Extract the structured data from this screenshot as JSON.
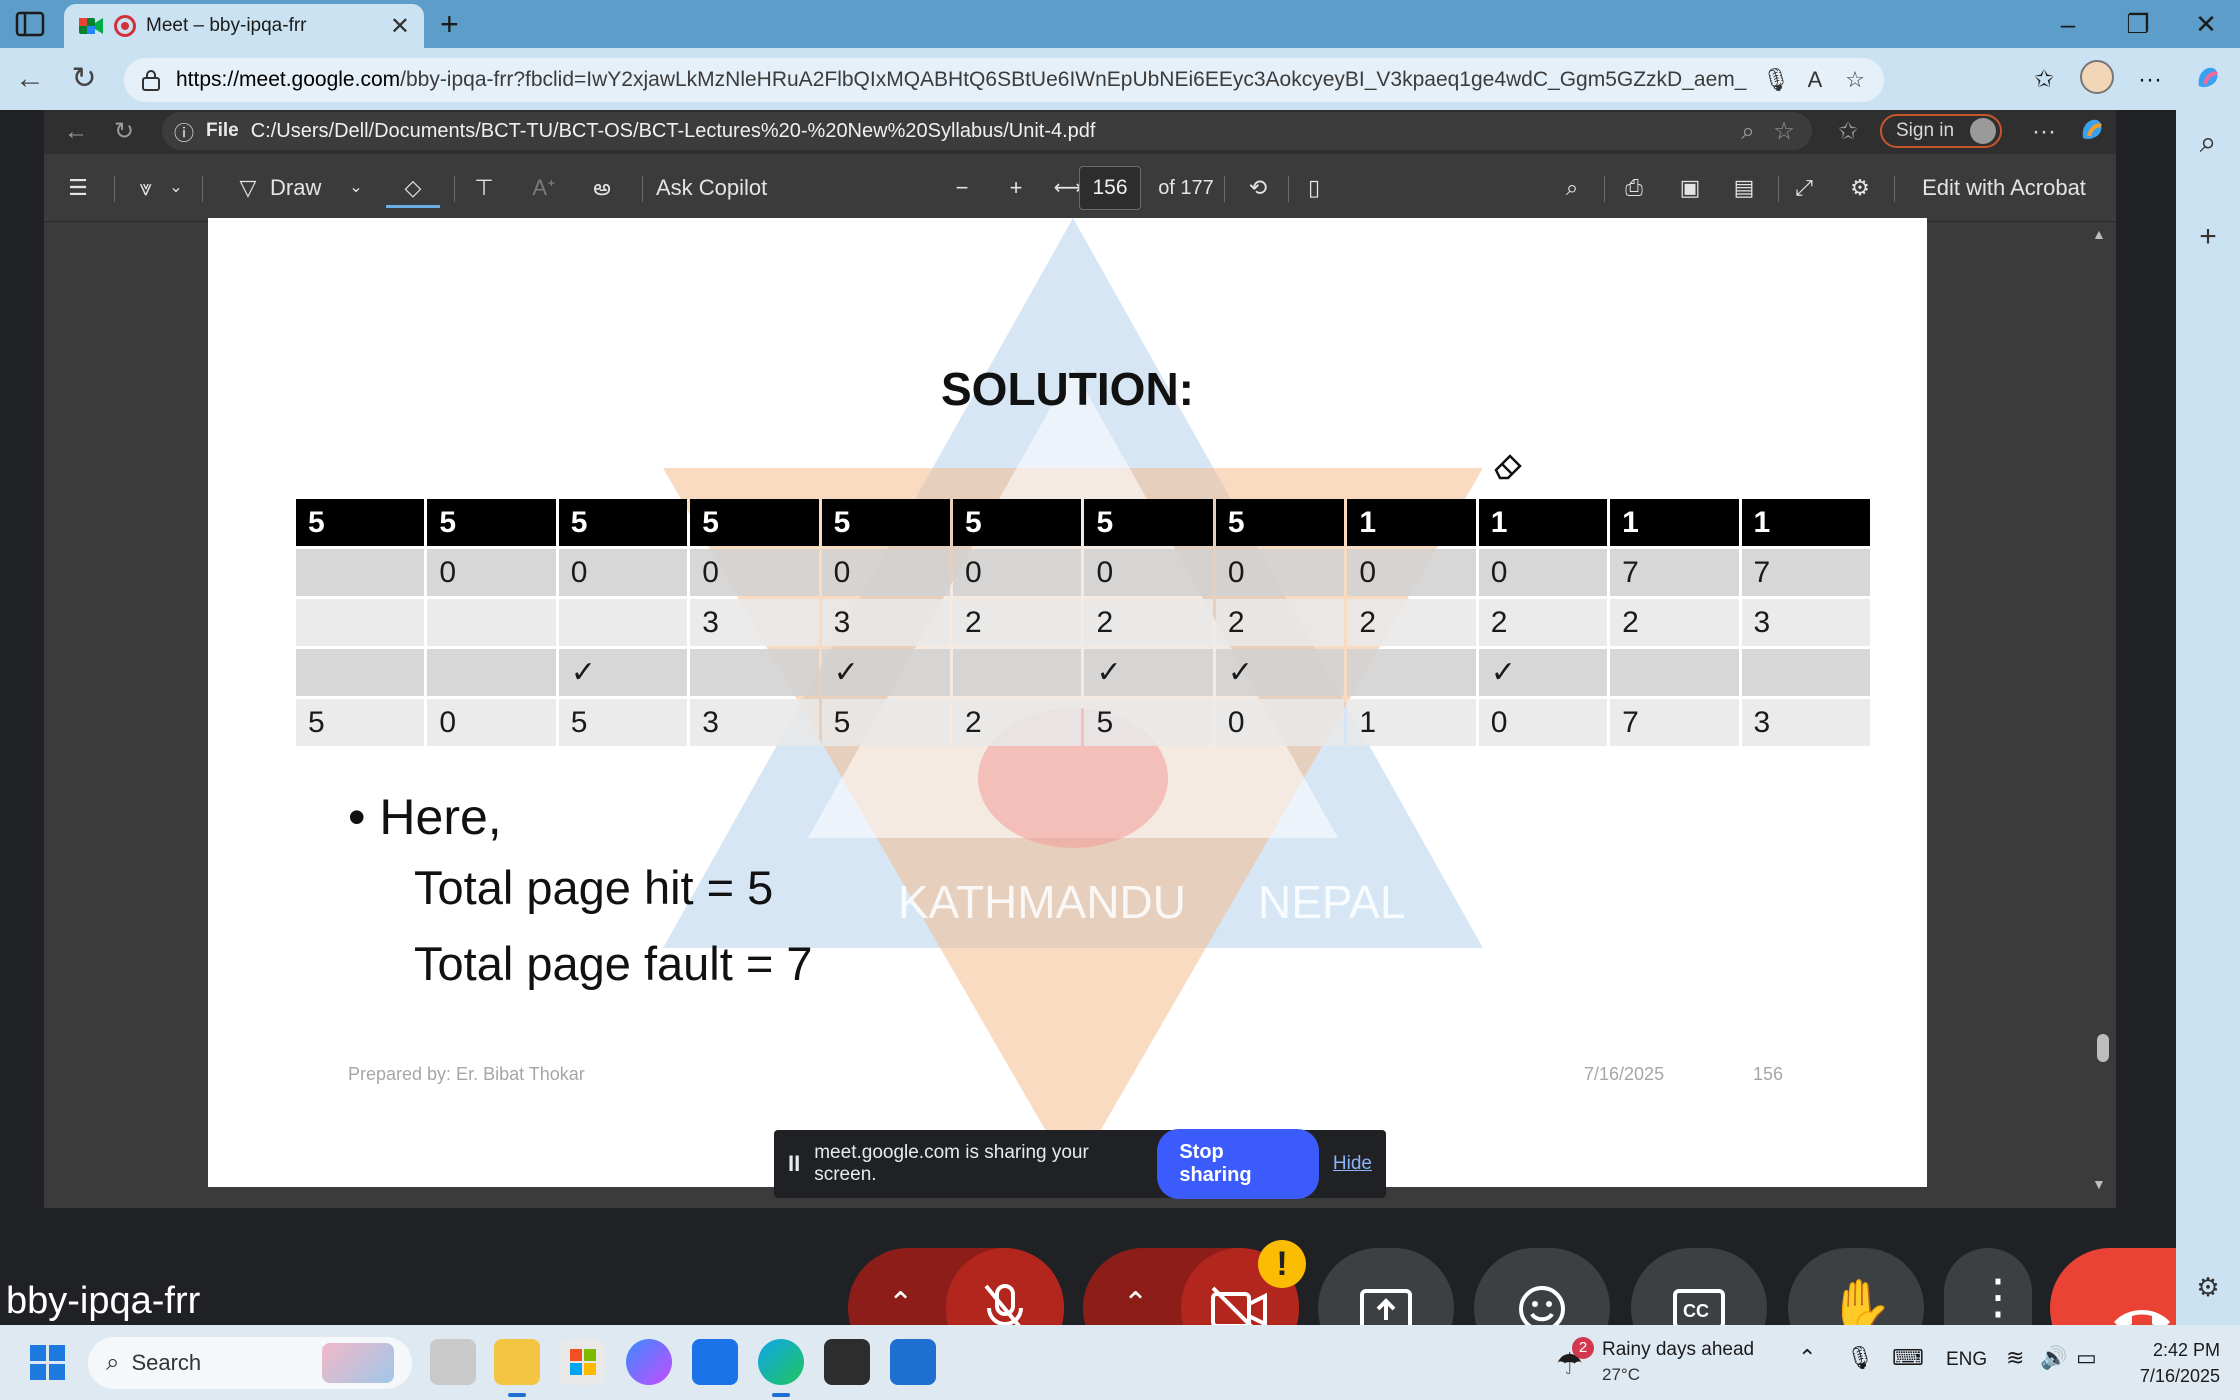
{
  "browser": {
    "tab_title": "Meet – bby-ipqa-frr",
    "url_host": "https://meet.google.com",
    "url_rest": "/bby-ipqa-frr?fbclid=IwY2xjawLkMzNleHRuA2FlbQIxMQABHtQ6SBtUe6IWnEpUbNEi6EEyc3AokcyeyBI_V3kpaeq1ge4wdC_Ggm5GZzkD_aem_HhvzVOQGwD..."
  },
  "shared_browser": {
    "file_label": "File",
    "path": "C:/Users/Dell/Documents/BCT-TU/BCT-OS/BCT-Lectures%20-%20New%20Syllabus/Unit-4.pdf",
    "sign_in": "Sign in"
  },
  "pdf_toolbar": {
    "draw_label": "Draw",
    "copilot_label": "Ask Copilot",
    "page_number": "156",
    "page_total": "of 177",
    "acrobat_label": "Edit with Acrobat"
  },
  "slide": {
    "title": "SOLUTION:",
    "table": {
      "header": [
        "5",
        "5",
        "5",
        "5",
        "5",
        "5",
        "5",
        "5",
        "1",
        "1",
        "1",
        "1"
      ],
      "rows": [
        [
          "",
          "0",
          "0",
          "0",
          "0",
          "0",
          "0",
          "0",
          "0",
          "0",
          "7",
          "7"
        ],
        [
          "",
          "",
          "",
          "3",
          "3",
          "2",
          "2",
          "2",
          "2",
          "2",
          "2",
          "3"
        ],
        [
          "",
          "",
          "✓",
          "",
          "✓",
          "",
          "✓",
          "✓",
          "",
          "✓",
          "",
          ""
        ],
        [
          "5",
          "0",
          "5",
          "3",
          "5",
          "2",
          "5",
          "0",
          "1",
          "0",
          "7",
          "3"
        ]
      ]
    },
    "bullet": "• Here,",
    "hit_line": "Total page hit = 5",
    "fault_line": "Total page fault = 7",
    "footer_author": "Prepared by: Er. Bibat Thokar",
    "footer_date": "7/16/2025",
    "footer_page": "156",
    "watermark_left": "KATHMANDU",
    "watermark_right": "NEPAL"
  },
  "share_banner": {
    "pause_glyph": "II",
    "message": "meet.google.com is sharing your screen.",
    "stop_label": "Stop sharing",
    "hide_label": "Hide"
  },
  "meeting": {
    "name": "bby-ipqa-frr",
    "warning_glyph": "!"
  },
  "taskbar": {
    "search_label": "Search",
    "weather_title": "Rainy days ahead",
    "weather_temp": "27°C",
    "weather_badge": "2",
    "language": "ENG",
    "time": "2:42 PM",
    "date": "7/16/2025"
  },
  "colors": {
    "browser_frame": "#5c9dc9",
    "browser_chrome": "#cbe2f2",
    "meet_background": "#202124",
    "stop_sharing": "#3b5bfd",
    "end_call": "#ea4335",
    "muted_control": "#8c1d18"
  }
}
